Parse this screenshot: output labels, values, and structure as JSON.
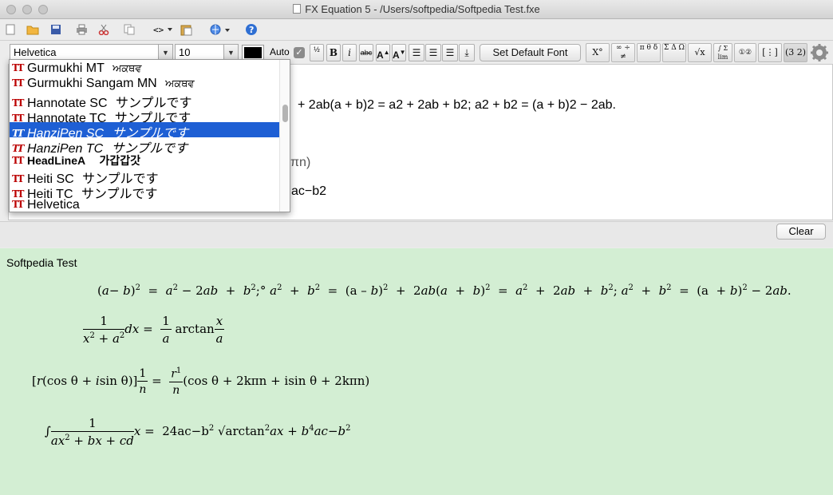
{
  "window": {
    "title": "FX Equation 5 - /Users/softpedia/Softpedia Test.fxe"
  },
  "toolbar2": {
    "font_family": "Helvetica",
    "font_size": "10",
    "auto_label": "Auto",
    "set_default_font": "Set Default Font",
    "bold": "B",
    "italic": "i",
    "strike": "abc"
  },
  "symbols": [
    "X°",
    "∞ ÷ ≠",
    "π θ δ",
    "Σ Δ Ω",
    "√x",
    "∫ Σ lim",
    "①②",
    "[⋮]",
    "(3 2)"
  ],
  "font_list": [
    {
      "name": "Gurmukhi MT",
      "sample": "ਅਕਥਵ"
    },
    {
      "name": "Gurmukhi Sangam MN",
      "sample": "ਅਕਥਵ"
    },
    {
      "name": "Hannotate SC",
      "sample": "サンプルです"
    },
    {
      "name": "Hannotate TC",
      "sample": "サンプルです"
    },
    {
      "name": "HanziPen SC",
      "sample": "サンプルです"
    },
    {
      "name": "HanziPen TC",
      "sample": "サンプルです"
    },
    {
      "name": "HeadLineA",
      "sample": "가갑갑갓"
    },
    {
      "name": "Heiti SC",
      "sample": "サンプルです"
    },
    {
      "name": "Heiti TC",
      "sample": "サンプルです"
    },
    {
      "name": "Helvetica",
      "sample": ""
    }
  ],
  "editor": {
    "line1": "+ 2ab(a + b)2 = a2 + 2ab + b2; a2 + b2 = (a + b)2 − 2ab.",
    "line2": "κπn)",
    "line3": "ac−b2"
  },
  "clear_label": "Clear",
  "preview": {
    "title": "Softpedia Test",
    "eq2_num": "1",
    "eq2_den": "x",
    "eq2_rest": "dx = ",
    "eq2_rhs_num": "1",
    "eq2_rhs_den": "a",
    "eq2_arctan": "arctan",
    "eq2_frac_num": "x",
    "eq2_frac_den": "a",
    "eq3": "(cos θ + 2kπn + isin θ + 2kπn)",
    "eq4_rhs": "24ac−b"
  }
}
